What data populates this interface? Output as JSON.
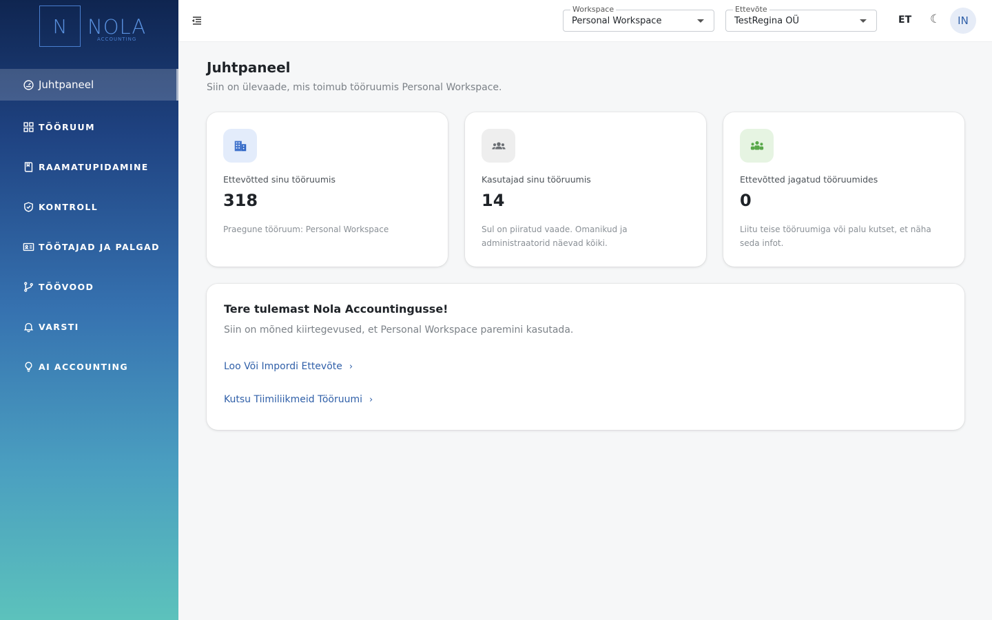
{
  "brand": {
    "mark": "N",
    "name": "NOLA",
    "tagline": "ACCOUNTING"
  },
  "sidebar": {
    "active": {
      "label": "Juhtpaneel",
      "icon": "dashboard-gauge-icon"
    },
    "items": [
      {
        "label": "TÖÖRUUM",
        "icon": "grid-icon"
      },
      {
        "label": "RAAMATUPIDAMINE",
        "icon": "book-icon"
      },
      {
        "label": "KONTROLL",
        "icon": "shield-check-icon"
      },
      {
        "label": "TÖÖTAJAD JA PALGAD",
        "icon": "id-card-icon"
      },
      {
        "label": "TÖÖVOOD",
        "icon": "git-branch-icon"
      },
      {
        "label": "VARSTI",
        "icon": "bell-icon"
      },
      {
        "label": "AI ACCOUNTING",
        "icon": "lightbulb-icon"
      }
    ]
  },
  "topbar": {
    "workspace": {
      "label": "Workspace",
      "value": "Personal Workspace"
    },
    "company": {
      "label": "Ettevõte",
      "value": "TestRegina OÜ"
    },
    "language": "ET",
    "theme_icon": "☾",
    "avatar_initials": "IN"
  },
  "page": {
    "title": "Juhtpaneel",
    "subtitle": "Siin on ülevaade, mis toimub tööruumis Personal Workspace."
  },
  "cards": [
    {
      "label": "Ettevõtted sinu tööruumis",
      "value": "318",
      "note": "Praegune tööruum: Personal Workspace",
      "icon": "building-icon",
      "icon_bg": "#e3ecfb",
      "icon_color": "#2f66c6"
    },
    {
      "label": "Kasutajad sinu tööruumis",
      "value": "14",
      "note": "Sul on piiratud vaade. Omanikud ja administraatorid näevad kõiki.",
      "icon": "users-icon",
      "icon_bg": "#eeeeee",
      "icon_color": "#6b6f74"
    },
    {
      "label": "Ettevõtted jagatud tööruumides",
      "value": "0",
      "note": "Liitu teise tööruumiga või palu kutset, et näha seda infot.",
      "icon": "groups-icon",
      "icon_bg": "#e6f4e2",
      "icon_color": "#59a84a"
    }
  ],
  "welcome": {
    "title": "Tere tulemast Nola Accountingusse!",
    "subtitle": "Siin on mõned kiirtegevused, et Personal Workspace paremini kasutada.",
    "links": [
      {
        "label": "Loo Või Impordi Ettevõte",
        "chevron": "›"
      },
      {
        "label": "Kutsu Tiimiliikmeid Tööruumi",
        "chevron": "›"
      }
    ]
  }
}
